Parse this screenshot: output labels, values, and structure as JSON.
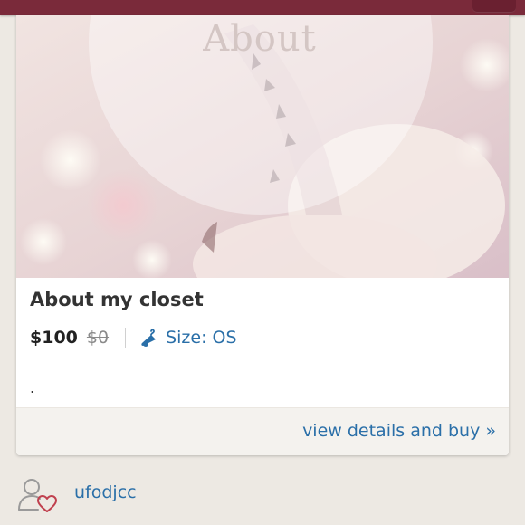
{
  "listing": {
    "overlay_text": "About",
    "title": "About my closet",
    "price": "$100",
    "original_price": "$0",
    "size_label": "Size: OS",
    "description": ".",
    "buy_link": "view details and buy »"
  },
  "seller": {
    "username": "ufodjcc"
  },
  "icons": {
    "size": "hanger-icon",
    "seller": "person-heart-icon"
  },
  "colors": {
    "header": "#7a2a3a",
    "link": "#2a6fa8",
    "background": "#ede9e3"
  }
}
